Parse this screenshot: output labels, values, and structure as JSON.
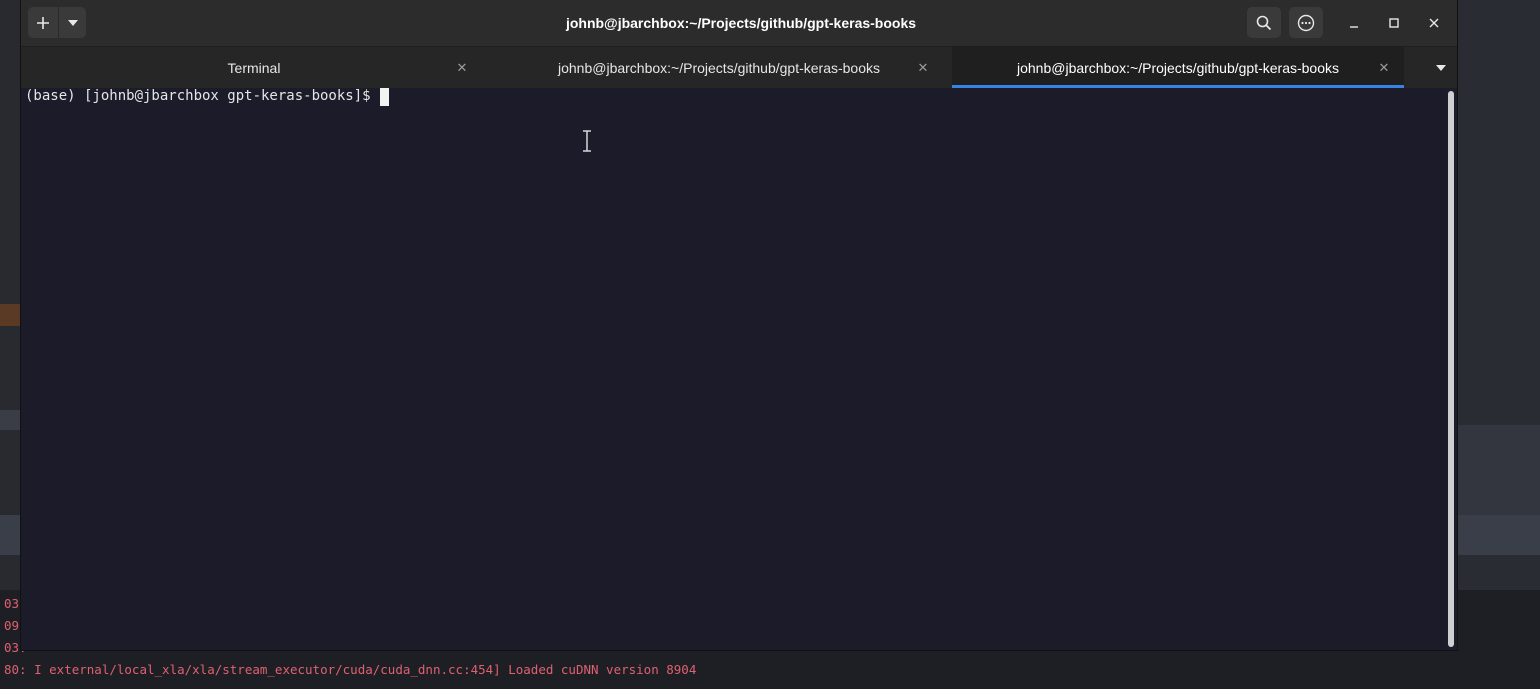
{
  "window": {
    "title": "johnb@jbarchbox:~/Projects/github/gpt-keras-books"
  },
  "titlebar": {
    "new_tab_icon": "plus-icon",
    "new_tab_menu_icon": "chevron-down-icon",
    "search_icon": "search-icon",
    "menu_icon": "more-horizontal-icon",
    "minimize_icon": "minimize-icon",
    "maximize_icon": "maximize-icon",
    "close_icon": "close-icon"
  },
  "tabs": [
    {
      "label": "Terminal",
      "active": false
    },
    {
      "label": "johnb@jbarchbox:~/Projects/github/gpt-keras-books",
      "active": false
    },
    {
      "label": "johnb@jbarchbox:~/Projects/github/gpt-keras-books",
      "active": true
    }
  ],
  "terminal": {
    "prompt": "(base) [johnb@jbarchbox gpt-keras-books]$ "
  },
  "background_log": {
    "lines": [
      "03",
      "09",
      "03.",
      "80: I external/local_xla/xla/stream_executor/cuda/cuda_dnn.cc:454] Loaded cuDNN version 8904"
    ]
  },
  "colors": {
    "accent": "#3584e4",
    "terminal_bg": "#1b1b29",
    "log_text": "#e06070"
  }
}
